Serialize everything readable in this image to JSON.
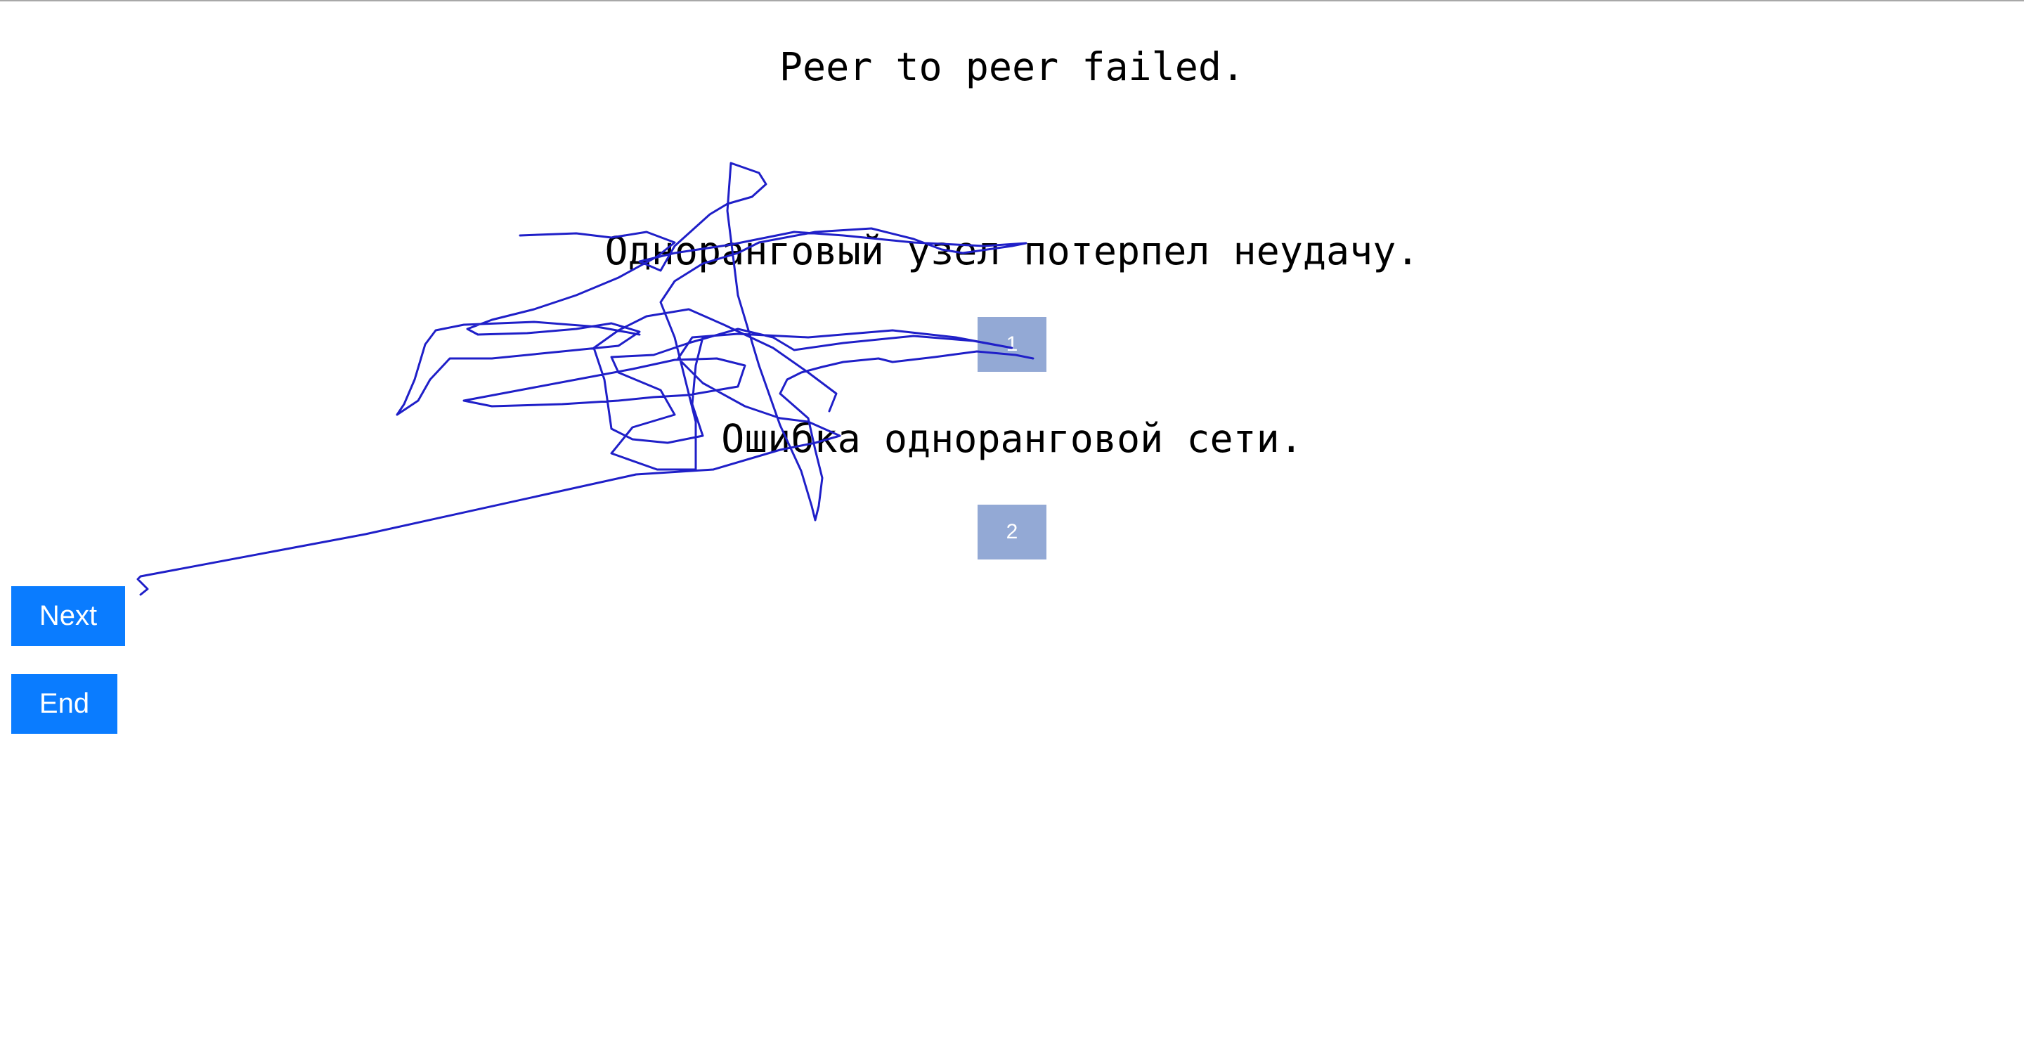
{
  "source_text": "Peer to peer failed.",
  "translations": [
    {
      "text": "Одноранговый узел потерпел неудачу.",
      "choice_label": "1"
    },
    {
      "text": "Ошибка одноранговой сети.",
      "choice_label": "2"
    }
  ],
  "buttons": {
    "next_label": "Next",
    "end_label": "End"
  },
  "colors": {
    "choice_box": "#93a9d5",
    "button": "#0a7cff",
    "scribble_stroke": "#1f1fc8"
  }
}
